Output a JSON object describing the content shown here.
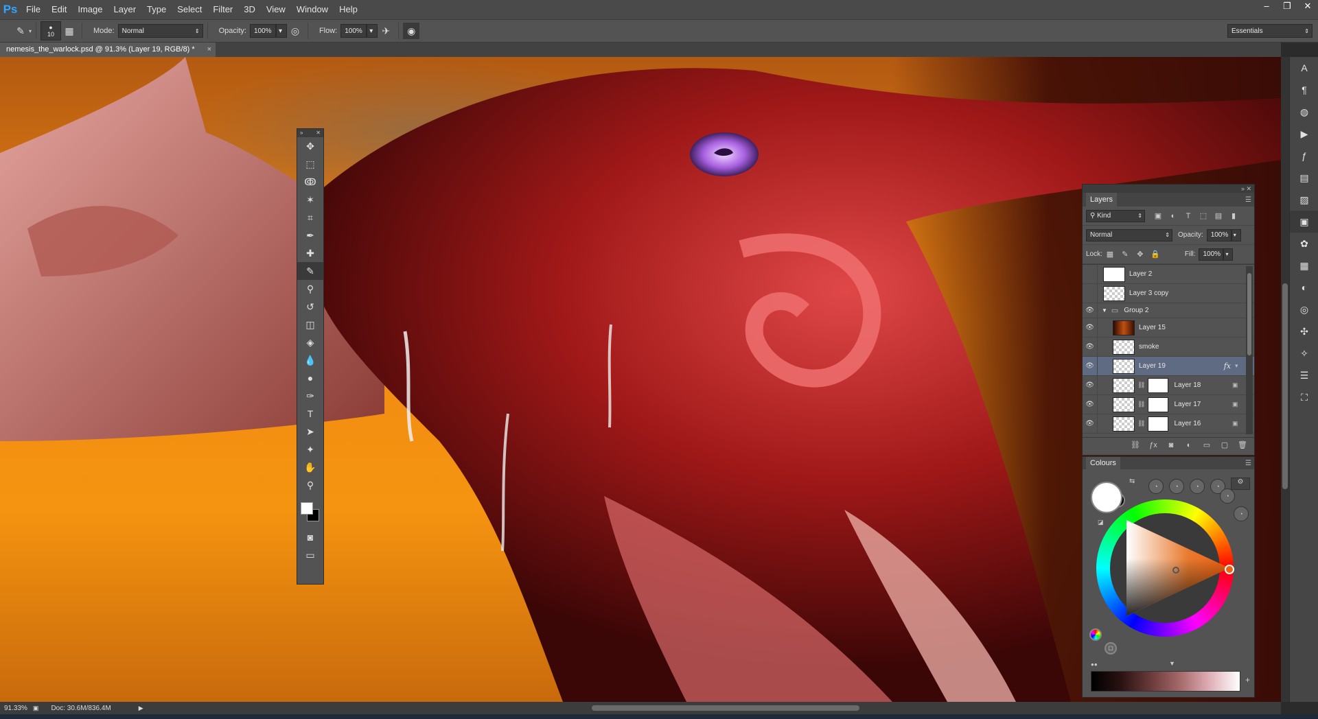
{
  "app": {
    "logo": "Ps",
    "menu": [
      "File",
      "Edit",
      "Image",
      "Layer",
      "Type",
      "Select",
      "Filter",
      "3D",
      "View",
      "Window",
      "Help"
    ],
    "window_controls": [
      "–",
      "❐",
      "✕"
    ]
  },
  "options_bar": {
    "brush_size": "10",
    "mode_label": "Mode:",
    "mode_value": "Normal",
    "opacity_label": "Opacity:",
    "opacity_value": "100%",
    "flow_label": "Flow:",
    "flow_value": "100%",
    "workspace": "Essentials"
  },
  "document": {
    "tab_title": "nemesis_the_warlock.psd @ 91.3% (Layer 19, RGB/8) *",
    "close": "×"
  },
  "status": {
    "zoom": "91.33%",
    "doc_info": "Doc: 30.6M/836.4M"
  },
  "layers_panel": {
    "title": "Layers",
    "filter_kind": "Kind",
    "blend_mode": "Normal",
    "opacity_label": "Opacity:",
    "opacity_value": "100%",
    "lock_label": "Lock:",
    "fill_label": "Fill:",
    "fill_value": "100%",
    "layers": [
      {
        "name": "Layer 2",
        "visible": false
      },
      {
        "name": "Layer 3 copy",
        "visible": false
      },
      {
        "name": "Group 2",
        "visible": true
      },
      {
        "name": "Layer 15",
        "visible": true
      },
      {
        "name": "smoke",
        "visible": true
      },
      {
        "name": "Layer 19",
        "visible": true,
        "fx": "fx"
      },
      {
        "name": "Layer 18",
        "visible": true
      },
      {
        "name": "Layer 17",
        "visible": true
      },
      {
        "name": "Layer 16",
        "visible": true
      }
    ]
  },
  "colours_panel": {
    "title": "Colours",
    "foreground": "#ffffff",
    "background": "#000000",
    "hue_accent": "#f06010"
  }
}
